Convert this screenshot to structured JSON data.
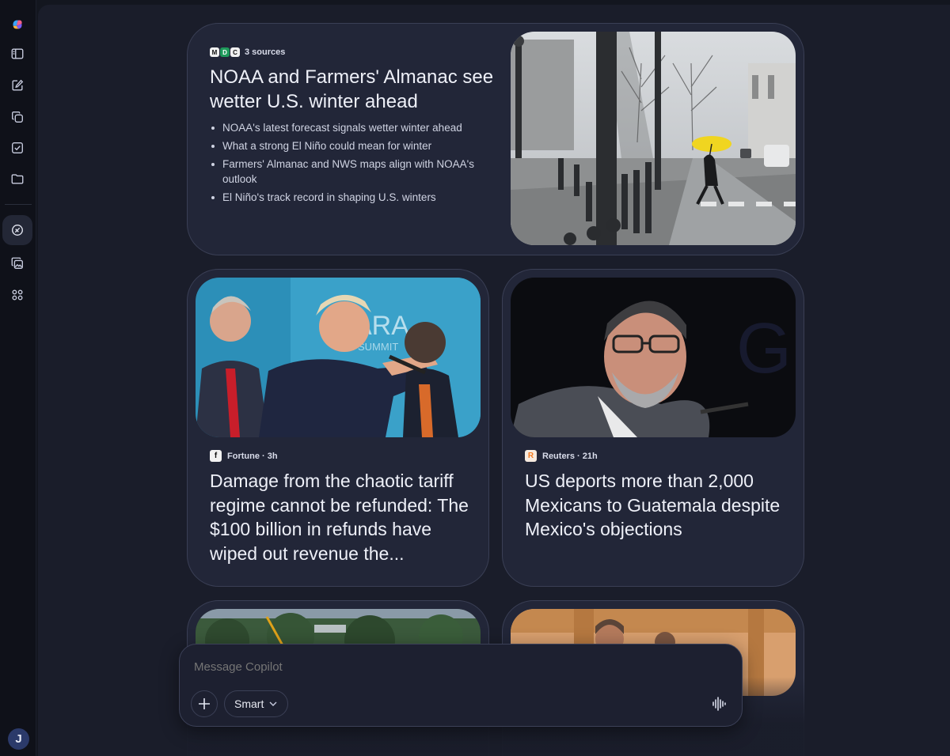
{
  "hero": {
    "sources_label": "3 sources",
    "title": "NOAA and Farmers' Almanac see wetter U.S. winter ahead",
    "bullets": [
      "NOAA's latest forecast signals wetter winter ahead",
      "What a strong El Niño could mean for winter",
      "Farmers' Almanac and NWS maps align with NOAA's outlook",
      "El Niño's track record in shaping U.S. winters"
    ],
    "source_logos": [
      "M",
      "D",
      "C"
    ]
  },
  "cards": [
    {
      "publisher": "Fortune · 3h",
      "publisher_initial": "f",
      "title": "Damage from the chaotic tariff regime cannot be refunded: The $100 billion in refunds have wiped out revenue the..."
    },
    {
      "publisher": "Reuters · 21h",
      "publisher_initial": "R",
      "title": "US deports more than 2,000 Mexicans to Guatemala despite Mexico's objections"
    }
  ],
  "composer": {
    "placeholder": "Message Copilot",
    "mode_label": "Smart"
  },
  "user": {
    "avatar_initial": "J"
  },
  "colors": {
    "background": "#1a1d2a",
    "card": "#222638",
    "border": "#3a3f55"
  },
  "icons": [
    "copilot-logo-icon",
    "sidebar-toggle-icon",
    "new-chat-icon",
    "library-icon",
    "tasks-icon",
    "folder-icon",
    "discover-icon",
    "imagine-icon",
    "apps-icon",
    "plus-icon",
    "chevron-down-icon",
    "voice-icon"
  ]
}
